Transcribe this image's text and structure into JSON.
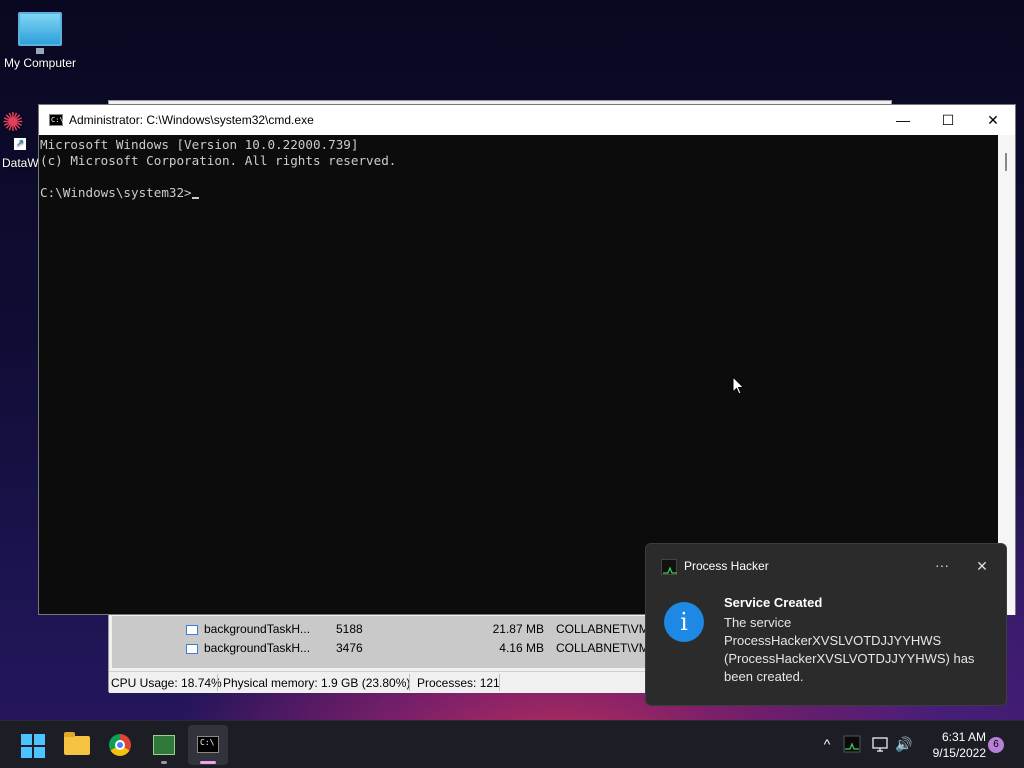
{
  "desktop": {
    "icons": [
      {
        "label": "My Computer"
      },
      {
        "label": "DataW"
      }
    ]
  },
  "process_hacker": {
    "rows": [
      {
        "name": "backgroundTaskH...",
        "pid": "5188",
        "memory": "21.87 MB",
        "user": "COLLABNET\\VM("
      },
      {
        "name": "backgroundTaskH...",
        "pid": "3476",
        "memory": "4.16 MB",
        "user": "COLLABNET\\VM("
      }
    ],
    "status": {
      "cpu": "CPU Usage: 18.74%",
      "memory": "Physical memory: 1.9 GB (23.80%)",
      "processes": "Processes: 121"
    }
  },
  "cmd": {
    "title": "Administrator: C:\\Windows\\system32\\cmd.exe",
    "lines": [
      "Microsoft Windows [Version 10.0.22000.739]",
      "(c) Microsoft Corporation. All rights reserved.",
      "",
      "C:\\Windows\\system32>"
    ],
    "buttons": {
      "minimize": "—",
      "maximize": "☐",
      "close": "✕"
    }
  },
  "notification": {
    "app": "Process Hacker",
    "more": "···",
    "close": "✕",
    "info_glyph": "i",
    "heading": "Service Created",
    "body": "The service ProcessHackerXVSLVOTDJJYYHWS (ProcessHackerXVSLVOTDJJYYHWS) has been created."
  },
  "taskbar": {
    "apps": [
      "start",
      "file-explorer",
      "chrome",
      "process-hacker",
      "command-prompt"
    ],
    "tray": {
      "chevron": "^",
      "volume": "🔊"
    },
    "time": "6:31 AM",
    "date": "9/15/2022",
    "notification_count": "6"
  },
  "colors": {
    "accent": "#4cc2ff",
    "toast_bg": "#2b2b2b",
    "info_blue": "#1e88e5",
    "terminal_bg": "#0c0c0c",
    "terminal_fg": "#cccccc"
  }
}
